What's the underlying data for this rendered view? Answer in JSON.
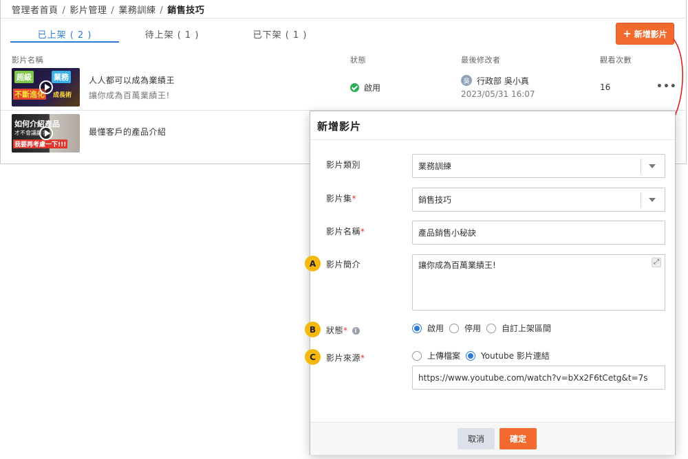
{
  "breadcrumb": {
    "items": [
      "管理者首頁",
      "影片管理",
      "業務訓練"
    ],
    "current": "銷售技巧",
    "separator": "/"
  },
  "tabs": [
    {
      "label": "已上架 ( 2 )",
      "active": true
    },
    {
      "label": "待上架 ( 1 )",
      "active": false
    },
    {
      "label": "已下架 ( 1 )",
      "active": false
    }
  ],
  "toolbar": {
    "add_icon": "plus-icon",
    "add_label": "新增影片"
  },
  "table": {
    "columns": [
      "影片名稱",
      "狀態",
      "最後修改者",
      "觀看次數"
    ],
    "rows": [
      {
        "thumb_text": [
          "超級",
          "業務",
          "不斷進化",
          "成長術"
        ],
        "title": "人人都可以成為業績王",
        "desc": "讓你成為百萬業績王!",
        "status": "啟用",
        "status_color": "#2fae5a",
        "avatar": "吳",
        "modifier": "行政部 吳小真",
        "modified_at": "2023/05/31 16:07",
        "views": "16",
        "more": "•••"
      },
      {
        "thumb_text": [
          "如何介紹產品",
          "才不會讓顧客...",
          "我要再考慮一下!!!"
        ],
        "title": "最懂客戶的產品介紹"
      }
    ]
  },
  "modal": {
    "title": "新增影片",
    "fields": {
      "category": {
        "label": "影片類別",
        "value": "業務訓練"
      },
      "collection": {
        "label": "影片集",
        "required": "*",
        "value": "銷售技巧"
      },
      "name": {
        "label": "影片名稱",
        "required": "*",
        "value": "產品銷售小秘訣"
      },
      "intro": {
        "label": "影片簡介",
        "marker": "A",
        "value": "讓你成為百萬業績王!",
        "expand_icon": "⤢"
      },
      "status": {
        "label": "狀態",
        "required": "*",
        "marker": "B",
        "info_icon": "i",
        "options": [
          "啟用",
          "停用",
          "自訂上架區間"
        ],
        "selected": "啟用"
      },
      "source": {
        "label": "影片來源",
        "required": "*",
        "marker": "C",
        "options": [
          "上傳檔案",
          "Youtube 影片連結"
        ],
        "selected": "Youtube 影片連結",
        "url": "https://www.youtube.com/watch?v=bXx2F6tCetg&t=7s"
      }
    },
    "cancel_label": "取消",
    "ok_label": "確定"
  },
  "colors": {
    "accent": "#f26a2e",
    "tab_active": "#2d7bd6",
    "marker": "#f7b80e",
    "required": "#e0342c",
    "arrow": "#e0201a"
  }
}
